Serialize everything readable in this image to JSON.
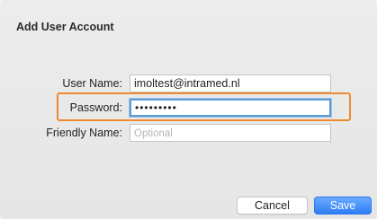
{
  "dialog": {
    "title": "Add User Account"
  },
  "form": {
    "username_label": "User Name:",
    "username_value": "imoltest@intramed.nl",
    "password_label": "Password:",
    "password_value": "•••••••••",
    "friendly_label": "Friendly Name:",
    "friendly_value": "",
    "friendly_placeholder": "Optional"
  },
  "buttons": {
    "cancel_label": "Cancel",
    "save_label": "Save"
  },
  "colors": {
    "highlight": "#f08a30",
    "focus_ring": "#5b9bd5",
    "primary_button": "#2f7ef5"
  }
}
